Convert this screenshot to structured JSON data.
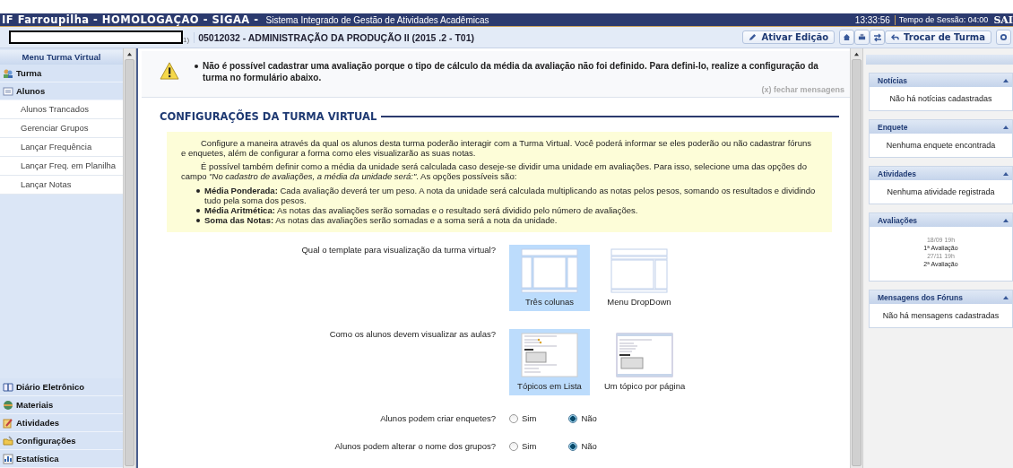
{
  "header": {
    "title": "IF Farroupilha - HOMOLOGAÇAO - SIGAA -",
    "subtitle": "Sistema Integrado de Gestão de Atividades Acadêmicas",
    "clock": "13:33:56",
    "session": "Tempo de Sessão: 04:00",
    "logout": "SAI"
  },
  "course_bar": {
    "user_suffix": "1)",
    "course": "05012032 - ADMINISTRAÇÃO DA PRODUÇÃO II (2015 .2 - T01)",
    "tools": [
      {
        "kind": "edit",
        "label": "Ativar Edição"
      },
      {
        "kind": "home"
      },
      {
        "kind": "print"
      },
      {
        "kind": "swap"
      },
      {
        "kind": "back",
        "label": "Trocar de Turma"
      },
      {
        "kind": "gear"
      }
    ]
  },
  "menu": {
    "title": "Menu Turma Virtual",
    "sections": [
      {
        "kind": "people",
        "label": "Turma"
      },
      {
        "kind": "list",
        "label": "Alunos",
        "children": [
          "Alunos Trancados",
          "Gerenciar Grupos",
          "Lançar Frequência",
          "Lançar Freq. em Planilha",
          "Lançar Notas"
        ]
      }
    ],
    "bottom_sections": [
      {
        "kind": "book",
        "label": "Diário Eletrônico"
      },
      {
        "kind": "globe",
        "label": "Materiais"
      },
      {
        "kind": "pencil",
        "label": "Atividades"
      },
      {
        "kind": "folder",
        "label": "Configurações"
      },
      {
        "kind": "chart",
        "label": "Estatística"
      }
    ]
  },
  "alert": {
    "message": "Não é possível cadastrar uma avaliação porque o tipo de cálculo da média da avaliação não foi definido. Para defini-lo, realize a configuração da turma no formulário abaixo.",
    "close": "(x) fechar mensagens"
  },
  "section_title": "CONFIGURAÇÕES DA TURMA VIRTUAL",
  "info": {
    "paragraphs": [
      "Configure a maneira através da qual os alunos desta turma poderão interagir com a Turma Virtual. Você poderá informar se eles poderão ou não cadastrar fóruns e enquetes, além de configurar a forma como eles visualizarão as suas notas.",
      "É possível também definir como a média da unidade será calculada caso deseje-se dividir uma unidade em avaliações. Para isso, selecione uma das opções do campo *\"No cadastro de avaliações, a média da unidade será:\"*. As opções possíveis são:"
    ],
    "options": [
      "**Média Ponderada:** Cada avaliação deverá ter um peso. A nota da unidade será calculada multiplicando as notas pelos pesos, somando os resultados e dividindo tudo pela soma dos pesos.",
      "**Média Aritmética:** As notas das avaliações serão somadas e o resultado será dividido pelo número de avaliações.",
      "**Soma das Notas:** As notas das avaliações serão somadas e a soma será a nota da unidade."
    ]
  },
  "form": {
    "choices": [
      {
        "label": "Qual o template para visualização da turma virtual?",
        "options": [
          {
            "kind": "three-columns",
            "label": "Três colunas",
            "selected": true
          },
          {
            "kind": "dropdown",
            "label": "Menu DropDown",
            "selected": false
          }
        ]
      },
      {
        "label": "Como os alunos devem visualizar as aulas?",
        "options": [
          {
            "kind": "topic-list",
            "label": "Tópicos em Lista",
            "selected": true
          },
          {
            "kind": "topic-page",
            "label": "Um tópico por página",
            "selected": false
          }
        ]
      }
    ],
    "radios": [
      {
        "label": "Alunos podem criar enquetes?",
        "options": [
          {
            "label": "Sim",
            "selected": false
          },
          {
            "label": "Não",
            "selected": true
          }
        ]
      },
      {
        "label": "Alunos podem alterar o nome dos grupos?",
        "options": [
          {
            "label": "Sim",
            "selected": false
          },
          {
            "label": "Não",
            "selected": true
          }
        ]
      }
    ]
  },
  "panels": [
    {
      "title": "Notícias",
      "text": "Não há notícias cadastradas"
    },
    {
      "title": "Enquete",
      "text": "Nenhuma enquete encontrada"
    },
    {
      "title": "Atividades",
      "text": "Nenhuma atividade registrada"
    },
    {
      "title": "Avaliações",
      "events": [
        {
          "date": "18/09 19h",
          "name": "1ª Avaliação"
        },
        {
          "date": "27/11 19h",
          "name": "2ª Avaliação"
        }
      ]
    },
    {
      "title": "Mensagens dos Fóruns",
      "text": "Não há mensagens cadastradas"
    }
  ]
}
